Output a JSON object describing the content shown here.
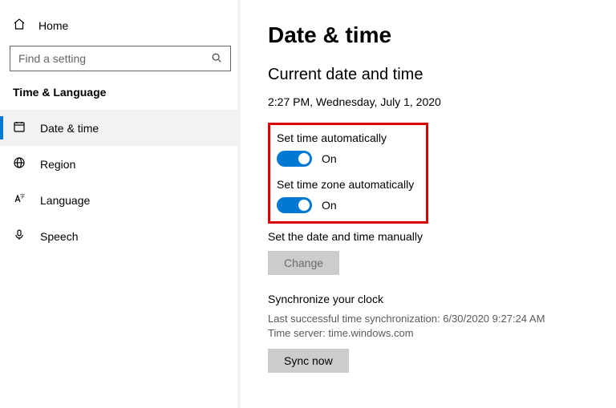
{
  "sidebar": {
    "home_label": "Home",
    "search_placeholder": "Find a setting",
    "category": "Time & Language",
    "items": [
      {
        "label": "Date & time"
      },
      {
        "label": "Region"
      },
      {
        "label": "Language"
      },
      {
        "label": "Speech"
      }
    ]
  },
  "main": {
    "title": "Date & time",
    "subtitle": "Current date and time",
    "current_datetime": "2:27 PM, Wednesday, July 1, 2020",
    "set_time_auto_label": "Set time automatically",
    "set_time_auto_state": "On",
    "set_tz_auto_label": "Set time zone automatically",
    "set_tz_auto_state": "On",
    "manual_label": "Set the date and time manually",
    "change_button": "Change",
    "sync_title": "Synchronize your clock",
    "sync_last": "Last successful time synchronization: 6/30/2020 9:27:24 AM",
    "sync_server": "Time server: time.windows.com",
    "sync_button": "Sync now"
  },
  "colors": {
    "accent": "#0078d4",
    "highlight": "#d80000"
  }
}
